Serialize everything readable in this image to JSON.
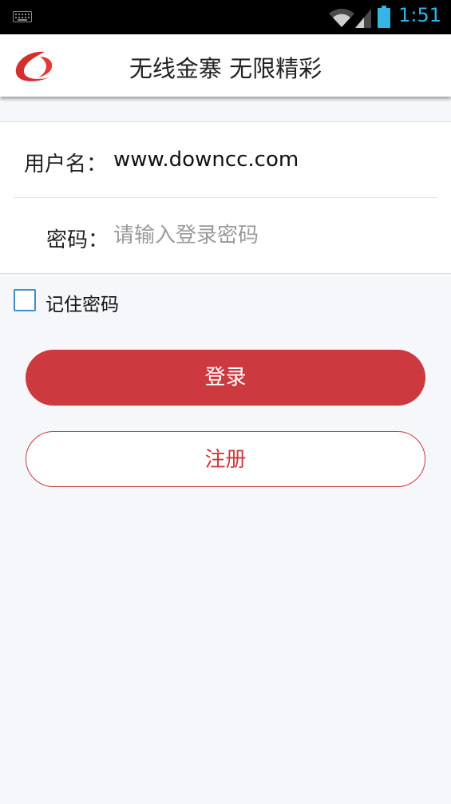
{
  "statusbar": {
    "time": "1:51",
    "icons": [
      "keyboard-icon",
      "wifi-icon",
      "signal-icon",
      "battery-icon"
    ],
    "accent": "#33b5e5"
  },
  "header": {
    "title": "无线金寨 无限精彩",
    "logo_icon": "logo-swoosh-icon",
    "logo_color": "#d32f2f"
  },
  "form": {
    "username_label": "用户名：",
    "username_value": "www.downcc.com",
    "password_label": "密码：",
    "password_placeholder": "请输入登录密码",
    "remember_label": "记住密码",
    "remember_checked": false
  },
  "actions": {
    "login_label": "登录",
    "register_label": "注册",
    "primary_color": "#cc3a3f"
  }
}
